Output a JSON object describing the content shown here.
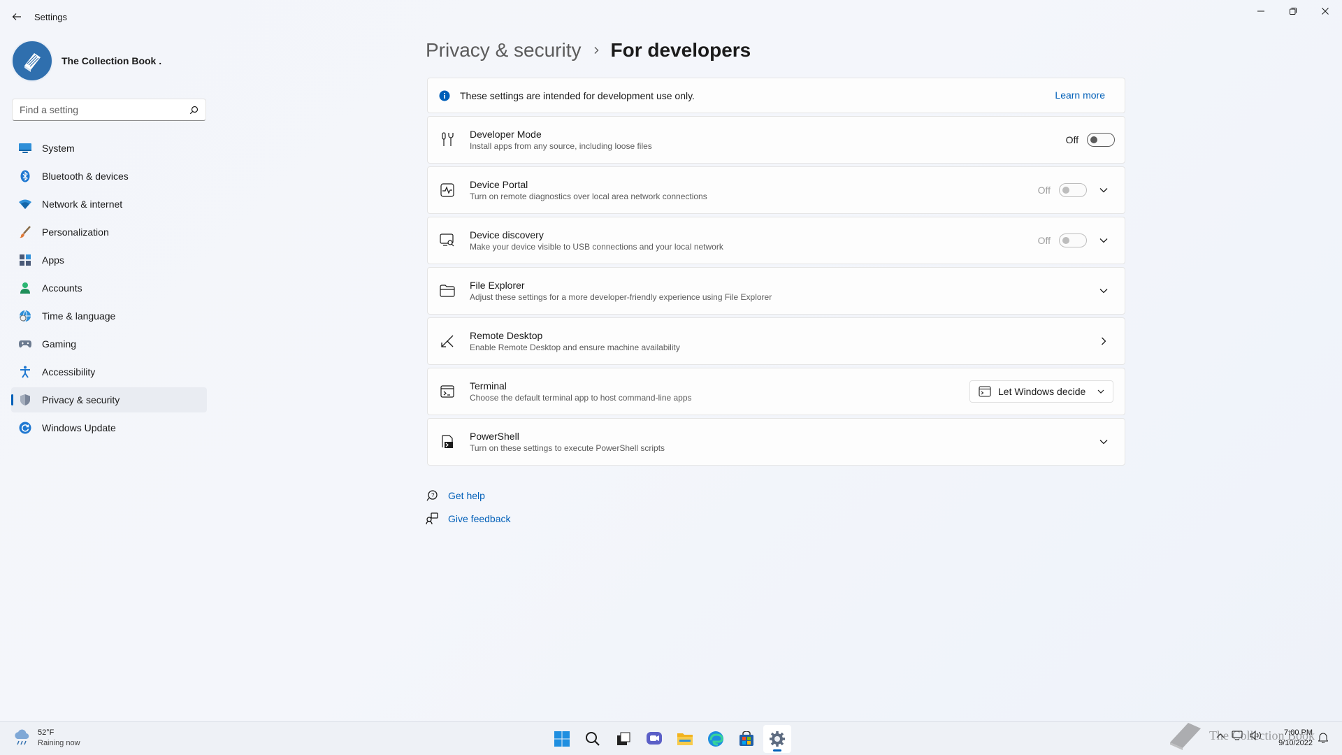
{
  "window": {
    "title": "Settings",
    "back_icon": "back-arrow-icon",
    "controls": [
      "minimize-icon",
      "restore-icon",
      "close-icon"
    ]
  },
  "profile": {
    "name": "The Collection Book .",
    "avatar_icon": "book-icon"
  },
  "search": {
    "placeholder": "Find a setting",
    "value": ""
  },
  "sidebar": {
    "items": [
      {
        "label": "System",
        "icon": "system-icon",
        "active": false
      },
      {
        "label": "Bluetooth & devices",
        "icon": "bluetooth-icon",
        "active": false
      },
      {
        "label": "Network & internet",
        "icon": "wifi-icon",
        "active": false
      },
      {
        "label": "Personalization",
        "icon": "brush-icon",
        "active": false
      },
      {
        "label": "Apps",
        "icon": "apps-icon",
        "active": false
      },
      {
        "label": "Accounts",
        "icon": "account-icon",
        "active": false
      },
      {
        "label": "Time & language",
        "icon": "globe-clock-icon",
        "active": false
      },
      {
        "label": "Gaming",
        "icon": "gamepad-icon",
        "active": false
      },
      {
        "label": "Accessibility",
        "icon": "accessibility-icon",
        "active": false
      },
      {
        "label": "Privacy & security",
        "icon": "shield-icon",
        "active": true
      },
      {
        "label": "Windows Update",
        "icon": "update-icon",
        "active": false
      }
    ]
  },
  "breadcrumb": {
    "parent": "Privacy & security",
    "current": "For developers"
  },
  "info_banner": {
    "text": "These settings are intended for development use only.",
    "link": "Learn more"
  },
  "settings": [
    {
      "title": "Developer Mode",
      "desc": "Install apps from any source, including loose files",
      "icon": "developer-tools-icon",
      "state": "Off"
    },
    {
      "title": "Device Portal",
      "desc": "Turn on remote diagnostics over local area network connections",
      "icon": "pulse-icon",
      "state": "Off"
    },
    {
      "title": "Device discovery",
      "desc": "Make your device visible to USB connections and your local network",
      "icon": "device-search-icon",
      "state": "Off"
    },
    {
      "title": "File Explorer",
      "desc": "Adjust these settings for a more developer-friendly experience using File Explorer",
      "icon": "folder-icon"
    },
    {
      "title": "Remote Desktop",
      "desc": "Enable Remote Desktop and ensure machine availability",
      "icon": "remote-desktop-icon"
    },
    {
      "title": "Terminal",
      "desc": "Choose the default terminal app to host command-line apps",
      "icon": "terminal-icon",
      "dropdown": "Let Windows decide"
    },
    {
      "title": "PowerShell",
      "desc": "Turn on these settings to execute PowerShell scripts",
      "icon": "powershell-icon"
    }
  ],
  "help_links": {
    "get_help": "Get help",
    "give_feedback": "Give feedback"
  },
  "taskbar": {
    "weather_temp": "52°F",
    "weather_desc": "Raining now",
    "time": "7:00 PM",
    "date": "9/10/2022",
    "apps": [
      "windows-start-icon",
      "search-icon",
      "task-view-icon",
      "chat-icon",
      "file-explorer-icon",
      "edge-icon",
      "store-icon",
      "settings-icon"
    ]
  },
  "watermark": {
    "text": "The Collection Book"
  },
  "colors": {
    "accent": "#005fb8",
    "background": "#f3f5fa",
    "card": "#fdfdfd"
  }
}
